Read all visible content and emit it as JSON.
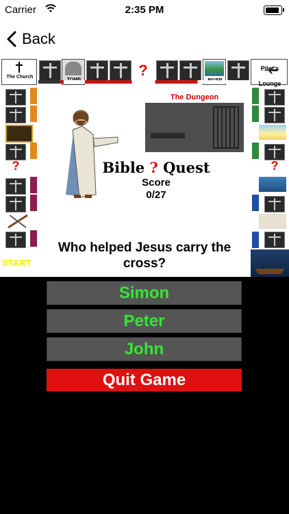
{
  "status": {
    "carrier": "Carrier",
    "time": "2:35 PM",
    "battery_level": 0.9
  },
  "nav": {
    "back_label": "Back"
  },
  "board": {
    "top_labels": {
      "church": "The Church",
      "tomb": "TOMB",
      "river": "RIVER",
      "pilots_lounge": "Pilot's Lounge"
    },
    "dungeon_title": "The Dungeon",
    "game_title_left": "Bible",
    "game_title_mark": "?",
    "game_title_right": "Quest",
    "score_label": "Score",
    "score_value": "0/27",
    "start_label": "START",
    "question": "Who helped Jesus carry the cross?"
  },
  "answers": [
    {
      "label": "Simon"
    },
    {
      "label": "Peter"
    },
    {
      "label": "John"
    }
  ],
  "quit_label": "Quit Game",
  "colors": {
    "answer_text": "#33e833",
    "answer_bg": "#555555",
    "quit_bg": "#e01010",
    "start_text": "#ffeb00",
    "question_mark": "#e01010"
  }
}
